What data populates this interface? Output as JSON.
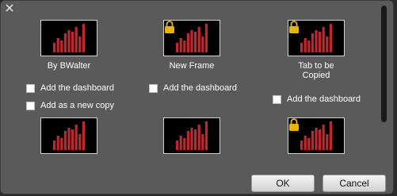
{
  "tiles": [
    {
      "name": "By BWalter",
      "locked": false,
      "options": [
        "Add the dashboard",
        "Add as a new copy"
      ]
    },
    {
      "name": "New Frame",
      "locked": true,
      "options": [
        "Add the dashboard"
      ]
    },
    {
      "name": "Tab to be Copied",
      "locked": true,
      "options": [
        "Add the dashboard"
      ]
    },
    {
      "name": "",
      "locked": false,
      "options": []
    },
    {
      "name": "",
      "locked": false,
      "options": []
    },
    {
      "name": "",
      "locked": true,
      "options": []
    }
  ],
  "buttons": {
    "ok": "OK",
    "cancel": "Cancel"
  },
  "icons": {
    "close": "close-icon",
    "thumbnail": "bar-chart-icon",
    "lock": "lock-icon"
  },
  "colors": {
    "bar": "#c0282f",
    "lock": "#e8b400",
    "dialog_bg": "#5a5a5a"
  }
}
